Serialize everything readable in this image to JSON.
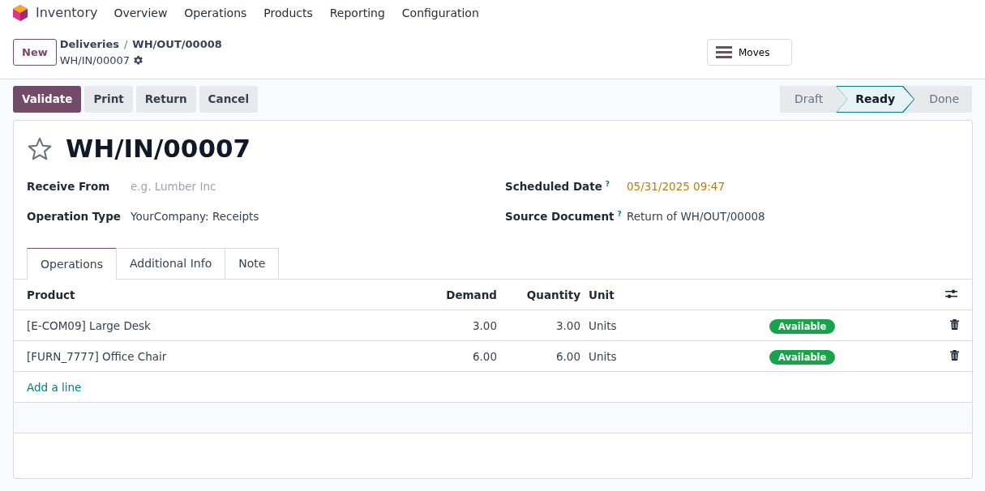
{
  "app": {
    "name": "Inventory"
  },
  "menu": [
    "Overview",
    "Operations",
    "Products",
    "Reporting",
    "Configuration"
  ],
  "new_button": "New",
  "breadcrumb": [
    "Deliveries",
    "WH/OUT/00008"
  ],
  "breadcrumb_separator": "/",
  "record_name": "WH/IN/00007",
  "moves_button": "Moves",
  "actions": [
    {
      "label": "Validate",
      "kind": "primary"
    },
    {
      "label": "Print",
      "kind": "secondary"
    },
    {
      "label": "Return",
      "kind": "secondary"
    },
    {
      "label": "Cancel",
      "kind": "secondary"
    }
  ],
  "statusbar": [
    {
      "label": "Draft",
      "selected": false
    },
    {
      "label": "Ready",
      "selected": true
    },
    {
      "label": "Done",
      "selected": false
    }
  ],
  "form": {
    "title": "WH/IN/00007",
    "starred": false,
    "fields_left": [
      {
        "label": "Receive From",
        "placeholder": "e.g. Lumber Inc",
        "help": false,
        "warning": false
      },
      {
        "label": "Operation Type",
        "value": "YourCompany: Receipts",
        "help": false,
        "warning": false
      }
    ],
    "fields_right": [
      {
        "label": "Scheduled Date",
        "help_mark": "?",
        "value": "05/31/2025 09:47",
        "help": true,
        "warning": true
      },
      {
        "label": "Source Document",
        "help_mark": "?",
        "value": "Return of WH/OUT/00008",
        "help": true,
        "warning": false
      }
    ]
  },
  "tabs": [
    {
      "label": "Operations",
      "selected": true
    },
    {
      "label": "Additional Info",
      "selected": false
    },
    {
      "label": "Note",
      "selected": false
    }
  ],
  "table": {
    "columns": [
      "Product",
      "Demand",
      "Quantity",
      "Unit"
    ],
    "rows": [
      {
        "product": "[E-COM09] Large Desk",
        "demand": "3.00",
        "quantity": "3.00",
        "unit": "Units",
        "status": "Available"
      },
      {
        "product": "[FURN_7777] Office Chair",
        "demand": "6.00",
        "quantity": "6.00",
        "unit": "Units",
        "status": "Available"
      }
    ],
    "add_line": "Add a line"
  }
}
